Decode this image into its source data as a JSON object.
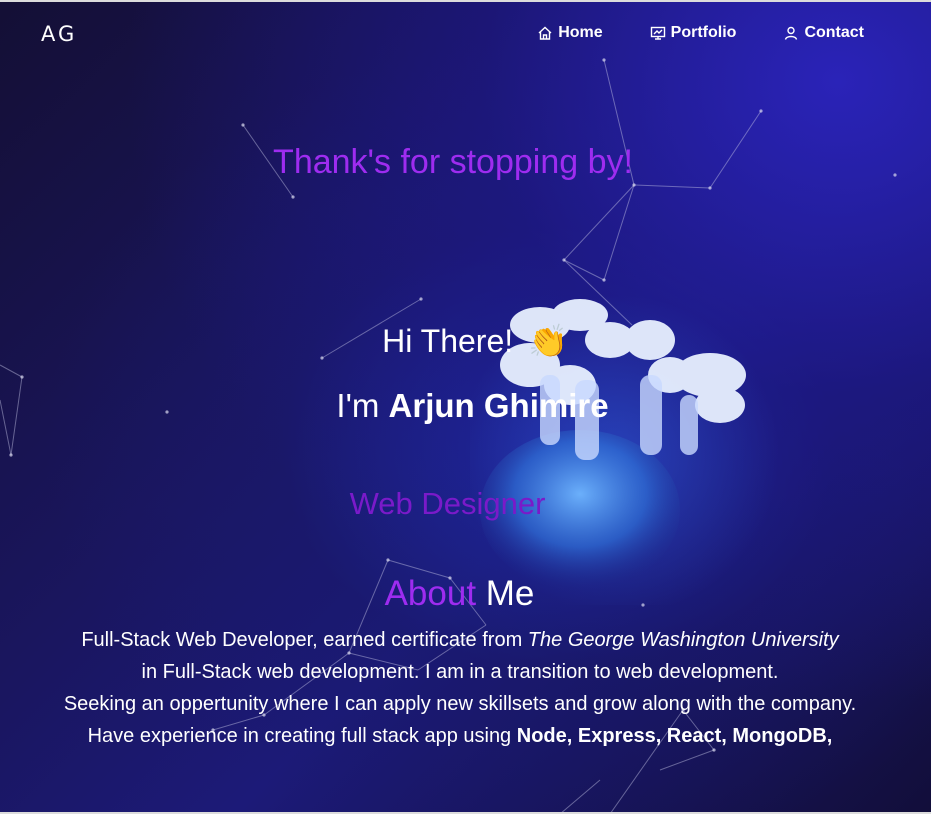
{
  "navbar": {
    "logo": "AG",
    "links": [
      {
        "label": "Home",
        "icon": "home-icon"
      },
      {
        "label": "Portfolio",
        "icon": "presentation-icon"
      },
      {
        "label": "Contact",
        "icon": "user-icon"
      }
    ]
  },
  "hero": {
    "thanks": "Thank's for stopping by!",
    "greeting": "Hi There!",
    "wave_emoji": "👏",
    "intro_prefix": "I'm ",
    "name": "Arjun Ghimire",
    "role": "Web Designer"
  },
  "about": {
    "title_accent": "About",
    "title_rest": " Me",
    "line1_prefix": "Full-Stack Web Developer, earned certificate from ",
    "line1_school": "The George Washington University",
    "line2": "in Full-Stack web development. I am in a transition to web development.",
    "line3": "Seeking an oppertunity where I can apply new skillsets and grow along with the company.",
    "line4_prefix": "Have experience in creating full stack app using ",
    "line4_stack": "Node, Express, React, MongoDB,"
  },
  "colors": {
    "accent": "#9e2cf0",
    "role": "#7a1ac9",
    "text": "#ffffff"
  }
}
